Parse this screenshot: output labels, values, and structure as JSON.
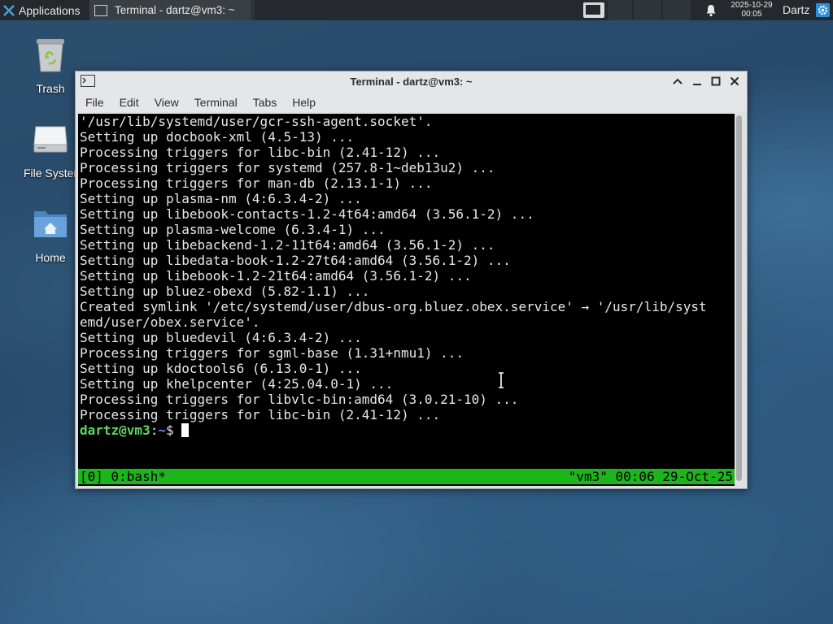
{
  "top_panel": {
    "apps_label": "Applications",
    "apps_icon": "xfce-menu-icon",
    "task_label": "Terminal - dartz@vm3: ~",
    "clock_date": "2025-10-29",
    "clock_time": "00:05",
    "user": "Dartz"
  },
  "desktop_icons": [
    {
      "label": "Trash",
      "icon": "trash-icon"
    },
    {
      "label": "File Syster",
      "icon": "drive-icon"
    },
    {
      "label": "Home",
      "icon": "home-folder-icon"
    }
  ],
  "window": {
    "title": "Terminal - dartz@vm3: ~",
    "menu": [
      "File",
      "Edit",
      "View",
      "Terminal",
      "Tabs",
      "Help"
    ]
  },
  "terminal": {
    "lines": [
      "'/usr/lib/systemd/user/gcr-ssh-agent.socket'.",
      "Setting up docbook-xml (4.5-13) ...",
      "Processing triggers for libc-bin (2.41-12) ...",
      "Processing triggers for systemd (257.8-1~deb13u2) ...",
      "Processing triggers for man-db (2.13.1-1) ...",
      "Setting up plasma-nm (4:6.3.4-2) ...",
      "Setting up libebook-contacts-1.2-4t64:amd64 (3.56.1-2) ...",
      "Setting up plasma-welcome (6.3.4-1) ...",
      "Setting up libebackend-1.2-11t64:amd64 (3.56.1-2) ...",
      "Setting up libedata-book-1.2-27t64:amd64 (3.56.1-2) ...",
      "Setting up libebook-1.2-21t64:amd64 (3.56.1-2) ...",
      "Setting up bluez-obexd (5.82-1.1) ...",
      "Created symlink '/etc/systemd/user/dbus-org.bluez.obex.service' → '/usr/lib/syst",
      "emd/user/obex.service'.",
      "Setting up bluedevil (4:6.3.4-2) ...",
      "Processing triggers for sgml-base (1.31+nmu1) ...",
      "Setting up kdoctools6 (6.13.0-1) ...",
      "Setting up khelpcenter (4:25.04.0-1) ...",
      "Processing triggers for libvlc-bin:amd64 (3.0.21-10) ...",
      "Processing triggers for libc-bin (2.41-12) ..."
    ],
    "prompt_user": "dartz@vm3",
    "prompt_sep": ":",
    "prompt_path": "~",
    "prompt_sign": "$ "
  },
  "tmux": {
    "left": "[0] 0:bash*",
    "right": "\"vm3\" 00:06 29-Oct-25",
    "color": "#1cb51c"
  }
}
